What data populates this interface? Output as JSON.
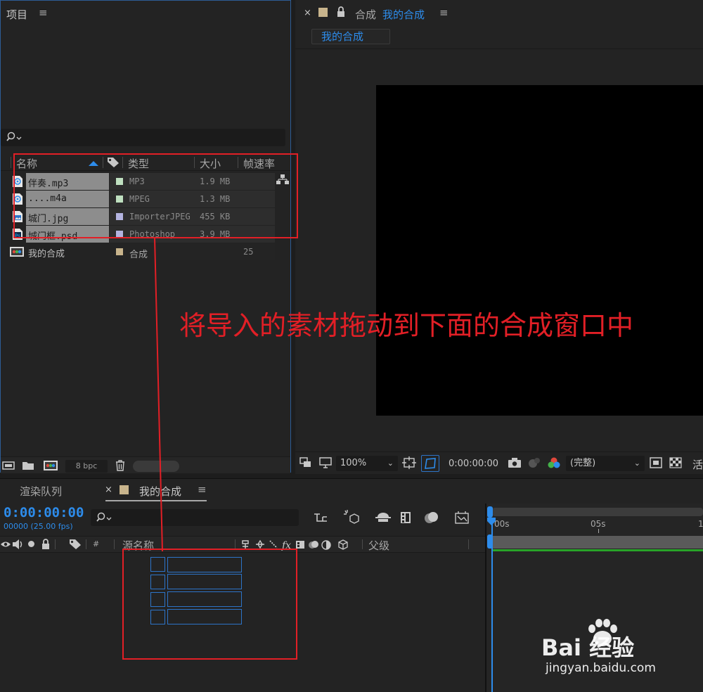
{
  "project": {
    "title": "项目",
    "menu": "≡",
    "columns": {
      "name": "名称",
      "type": "类型",
      "size": "大小",
      "fps": "帧速率"
    },
    "items": [
      {
        "name": "伴奏.mp3",
        "type": "MP3",
        "size": "1.9 MB",
        "fps": "",
        "color": "#bfe0c0",
        "icon": "audio-file-icon"
      },
      {
        "name": "....m4a",
        "type": "MPEG",
        "size": "1.3 MB",
        "fps": "",
        "color": "#bfe0c0",
        "icon": "audio-file-icon"
      },
      {
        "name": "城门.jpg",
        "type": "ImporterJPEG",
        "size": "455 KB",
        "fps": "",
        "color": "#b3b3e0",
        "icon": "image-file-icon"
      },
      {
        "name": "城门框.psd",
        "type": "Photoshop",
        "size": "3.9 MB",
        "fps": "",
        "color": "#b3b3e0",
        "icon": "photoshop-file-icon"
      },
      {
        "name": "我的合成",
        "type": "合成",
        "size": "",
        "fps": "25",
        "color": "#c8b48c",
        "icon": "composition-icon"
      }
    ],
    "bpc": "8 bpc"
  },
  "comp_viewer": {
    "tab_prefix": "合成",
    "tab_name": "我的合成",
    "breadcrumb": "我的合成",
    "zoom": "100%",
    "timecode": "0:00:00:00",
    "resolution": "(完整)",
    "extra_label": "活"
  },
  "timeline": {
    "tab_render": "渲染队列",
    "tab_comp": "我的合成",
    "timecode": "0:00:00:00",
    "frames": "00000 (25.00 fps)",
    "col_source": "源名称",
    "col_parent": "父级",
    "col_hash": "#",
    "ruler": {
      "t0": "00s",
      "t1": "05s",
      "t2": "1"
    }
  },
  "annotation": "将导入的素材拖动到下面的合成窗口中",
  "watermark": {
    "brand": "Bai 经验",
    "url": "jingyan.baidu.com"
  }
}
